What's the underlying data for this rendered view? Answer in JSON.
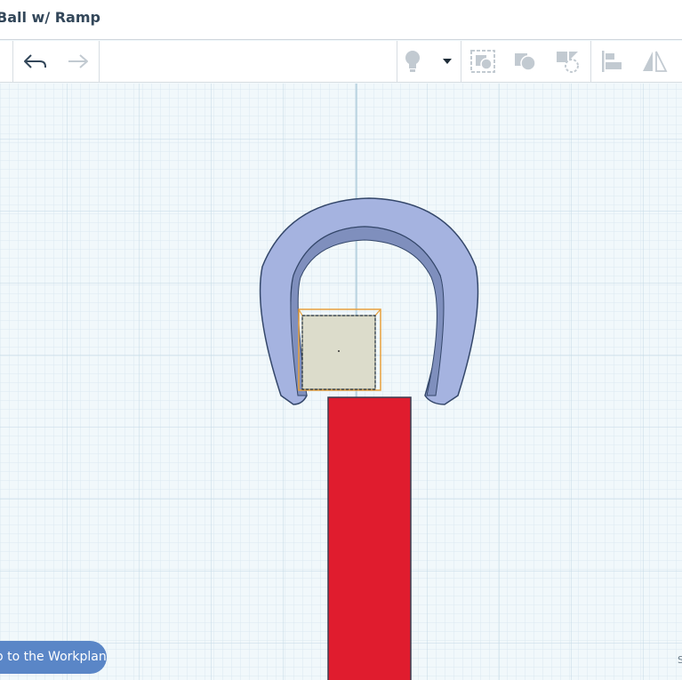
{
  "title": "Ball w/ Ramp",
  "toolbar": {
    "undo_icon": "undo-icon",
    "redo_icon": "redo-icon",
    "light_icon": "lightbulb-icon",
    "dropdown_icon": "caret-down-icon",
    "group_icon": "group-icon",
    "solid_icon": "solid-shape-icon",
    "hole_icon": "hole-shape-icon",
    "align_icon": "align-icon",
    "mirror_icon": "mirror-icon"
  },
  "footer": {
    "drop_label": "Drop to the Workplane",
    "corner_text": "S"
  },
  "colors": {
    "grid_bg": "#f1f8fb",
    "grid_minor": "#dbe9f0",
    "grid_major": "#c3d9e4",
    "arch": "#a5b3e0",
    "arch_inner": "#7f8fbd",
    "box_fill": "#dcdccb",
    "selection": "#e8a03c",
    "block": "#e01c2e",
    "pill": "#5a86c7"
  }
}
